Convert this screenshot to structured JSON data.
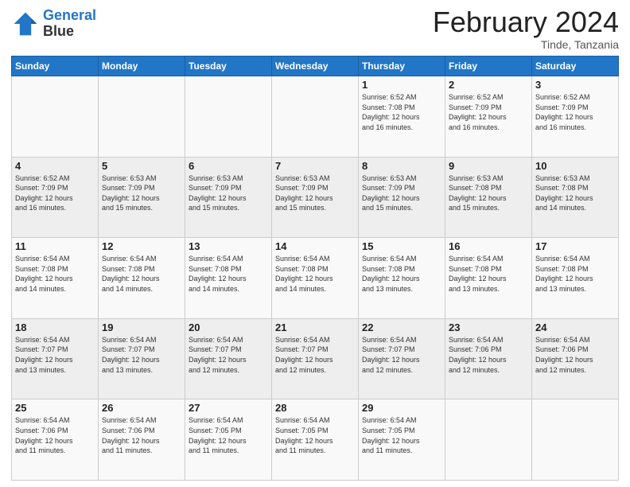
{
  "logo": {
    "line1": "General",
    "line2": "Blue"
  },
  "title": "February 2024",
  "location": "Tinde, Tanzania",
  "days_header": [
    "Sunday",
    "Monday",
    "Tuesday",
    "Wednesday",
    "Thursday",
    "Friday",
    "Saturday"
  ],
  "weeks": [
    [
      {
        "day": "",
        "info": ""
      },
      {
        "day": "",
        "info": ""
      },
      {
        "day": "",
        "info": ""
      },
      {
        "day": "",
        "info": ""
      },
      {
        "day": "1",
        "info": "Sunrise: 6:52 AM\nSunset: 7:08 PM\nDaylight: 12 hours\nand 16 minutes."
      },
      {
        "day": "2",
        "info": "Sunrise: 6:52 AM\nSunset: 7:09 PM\nDaylight: 12 hours\nand 16 minutes."
      },
      {
        "day": "3",
        "info": "Sunrise: 6:52 AM\nSunset: 7:09 PM\nDaylight: 12 hours\nand 16 minutes."
      }
    ],
    [
      {
        "day": "4",
        "info": "Sunrise: 6:52 AM\nSunset: 7:09 PM\nDaylight: 12 hours\nand 16 minutes."
      },
      {
        "day": "5",
        "info": "Sunrise: 6:53 AM\nSunset: 7:09 PM\nDaylight: 12 hours\nand 15 minutes."
      },
      {
        "day": "6",
        "info": "Sunrise: 6:53 AM\nSunset: 7:09 PM\nDaylight: 12 hours\nand 15 minutes."
      },
      {
        "day": "7",
        "info": "Sunrise: 6:53 AM\nSunset: 7:09 PM\nDaylight: 12 hours\nand 15 minutes."
      },
      {
        "day": "8",
        "info": "Sunrise: 6:53 AM\nSunset: 7:09 PM\nDaylight: 12 hours\nand 15 minutes."
      },
      {
        "day": "9",
        "info": "Sunrise: 6:53 AM\nSunset: 7:08 PM\nDaylight: 12 hours\nand 15 minutes."
      },
      {
        "day": "10",
        "info": "Sunrise: 6:53 AM\nSunset: 7:08 PM\nDaylight: 12 hours\nand 14 minutes."
      }
    ],
    [
      {
        "day": "11",
        "info": "Sunrise: 6:54 AM\nSunset: 7:08 PM\nDaylight: 12 hours\nand 14 minutes."
      },
      {
        "day": "12",
        "info": "Sunrise: 6:54 AM\nSunset: 7:08 PM\nDaylight: 12 hours\nand 14 minutes."
      },
      {
        "day": "13",
        "info": "Sunrise: 6:54 AM\nSunset: 7:08 PM\nDaylight: 12 hours\nand 14 minutes."
      },
      {
        "day": "14",
        "info": "Sunrise: 6:54 AM\nSunset: 7:08 PM\nDaylight: 12 hours\nand 14 minutes."
      },
      {
        "day": "15",
        "info": "Sunrise: 6:54 AM\nSunset: 7:08 PM\nDaylight: 12 hours\nand 13 minutes."
      },
      {
        "day": "16",
        "info": "Sunrise: 6:54 AM\nSunset: 7:08 PM\nDaylight: 12 hours\nand 13 minutes."
      },
      {
        "day": "17",
        "info": "Sunrise: 6:54 AM\nSunset: 7:08 PM\nDaylight: 12 hours\nand 13 minutes."
      }
    ],
    [
      {
        "day": "18",
        "info": "Sunrise: 6:54 AM\nSunset: 7:07 PM\nDaylight: 12 hours\nand 13 minutes."
      },
      {
        "day": "19",
        "info": "Sunrise: 6:54 AM\nSunset: 7:07 PM\nDaylight: 12 hours\nand 13 minutes."
      },
      {
        "day": "20",
        "info": "Sunrise: 6:54 AM\nSunset: 7:07 PM\nDaylight: 12 hours\nand 12 minutes."
      },
      {
        "day": "21",
        "info": "Sunrise: 6:54 AM\nSunset: 7:07 PM\nDaylight: 12 hours\nand 12 minutes."
      },
      {
        "day": "22",
        "info": "Sunrise: 6:54 AM\nSunset: 7:07 PM\nDaylight: 12 hours\nand 12 minutes."
      },
      {
        "day": "23",
        "info": "Sunrise: 6:54 AM\nSunset: 7:06 PM\nDaylight: 12 hours\nand 12 minutes."
      },
      {
        "day": "24",
        "info": "Sunrise: 6:54 AM\nSunset: 7:06 PM\nDaylight: 12 hours\nand 12 minutes."
      }
    ],
    [
      {
        "day": "25",
        "info": "Sunrise: 6:54 AM\nSunset: 7:06 PM\nDaylight: 12 hours\nand 11 minutes."
      },
      {
        "day": "26",
        "info": "Sunrise: 6:54 AM\nSunset: 7:06 PM\nDaylight: 12 hours\nand 11 minutes."
      },
      {
        "day": "27",
        "info": "Sunrise: 6:54 AM\nSunset: 7:05 PM\nDaylight: 12 hours\nand 11 minutes."
      },
      {
        "day": "28",
        "info": "Sunrise: 6:54 AM\nSunset: 7:05 PM\nDaylight: 12 hours\nand 11 minutes."
      },
      {
        "day": "29",
        "info": "Sunrise: 6:54 AM\nSunset: 7:05 PM\nDaylight: 12 hours\nand 11 minutes."
      },
      {
        "day": "",
        "info": ""
      },
      {
        "day": "",
        "info": ""
      }
    ]
  ]
}
